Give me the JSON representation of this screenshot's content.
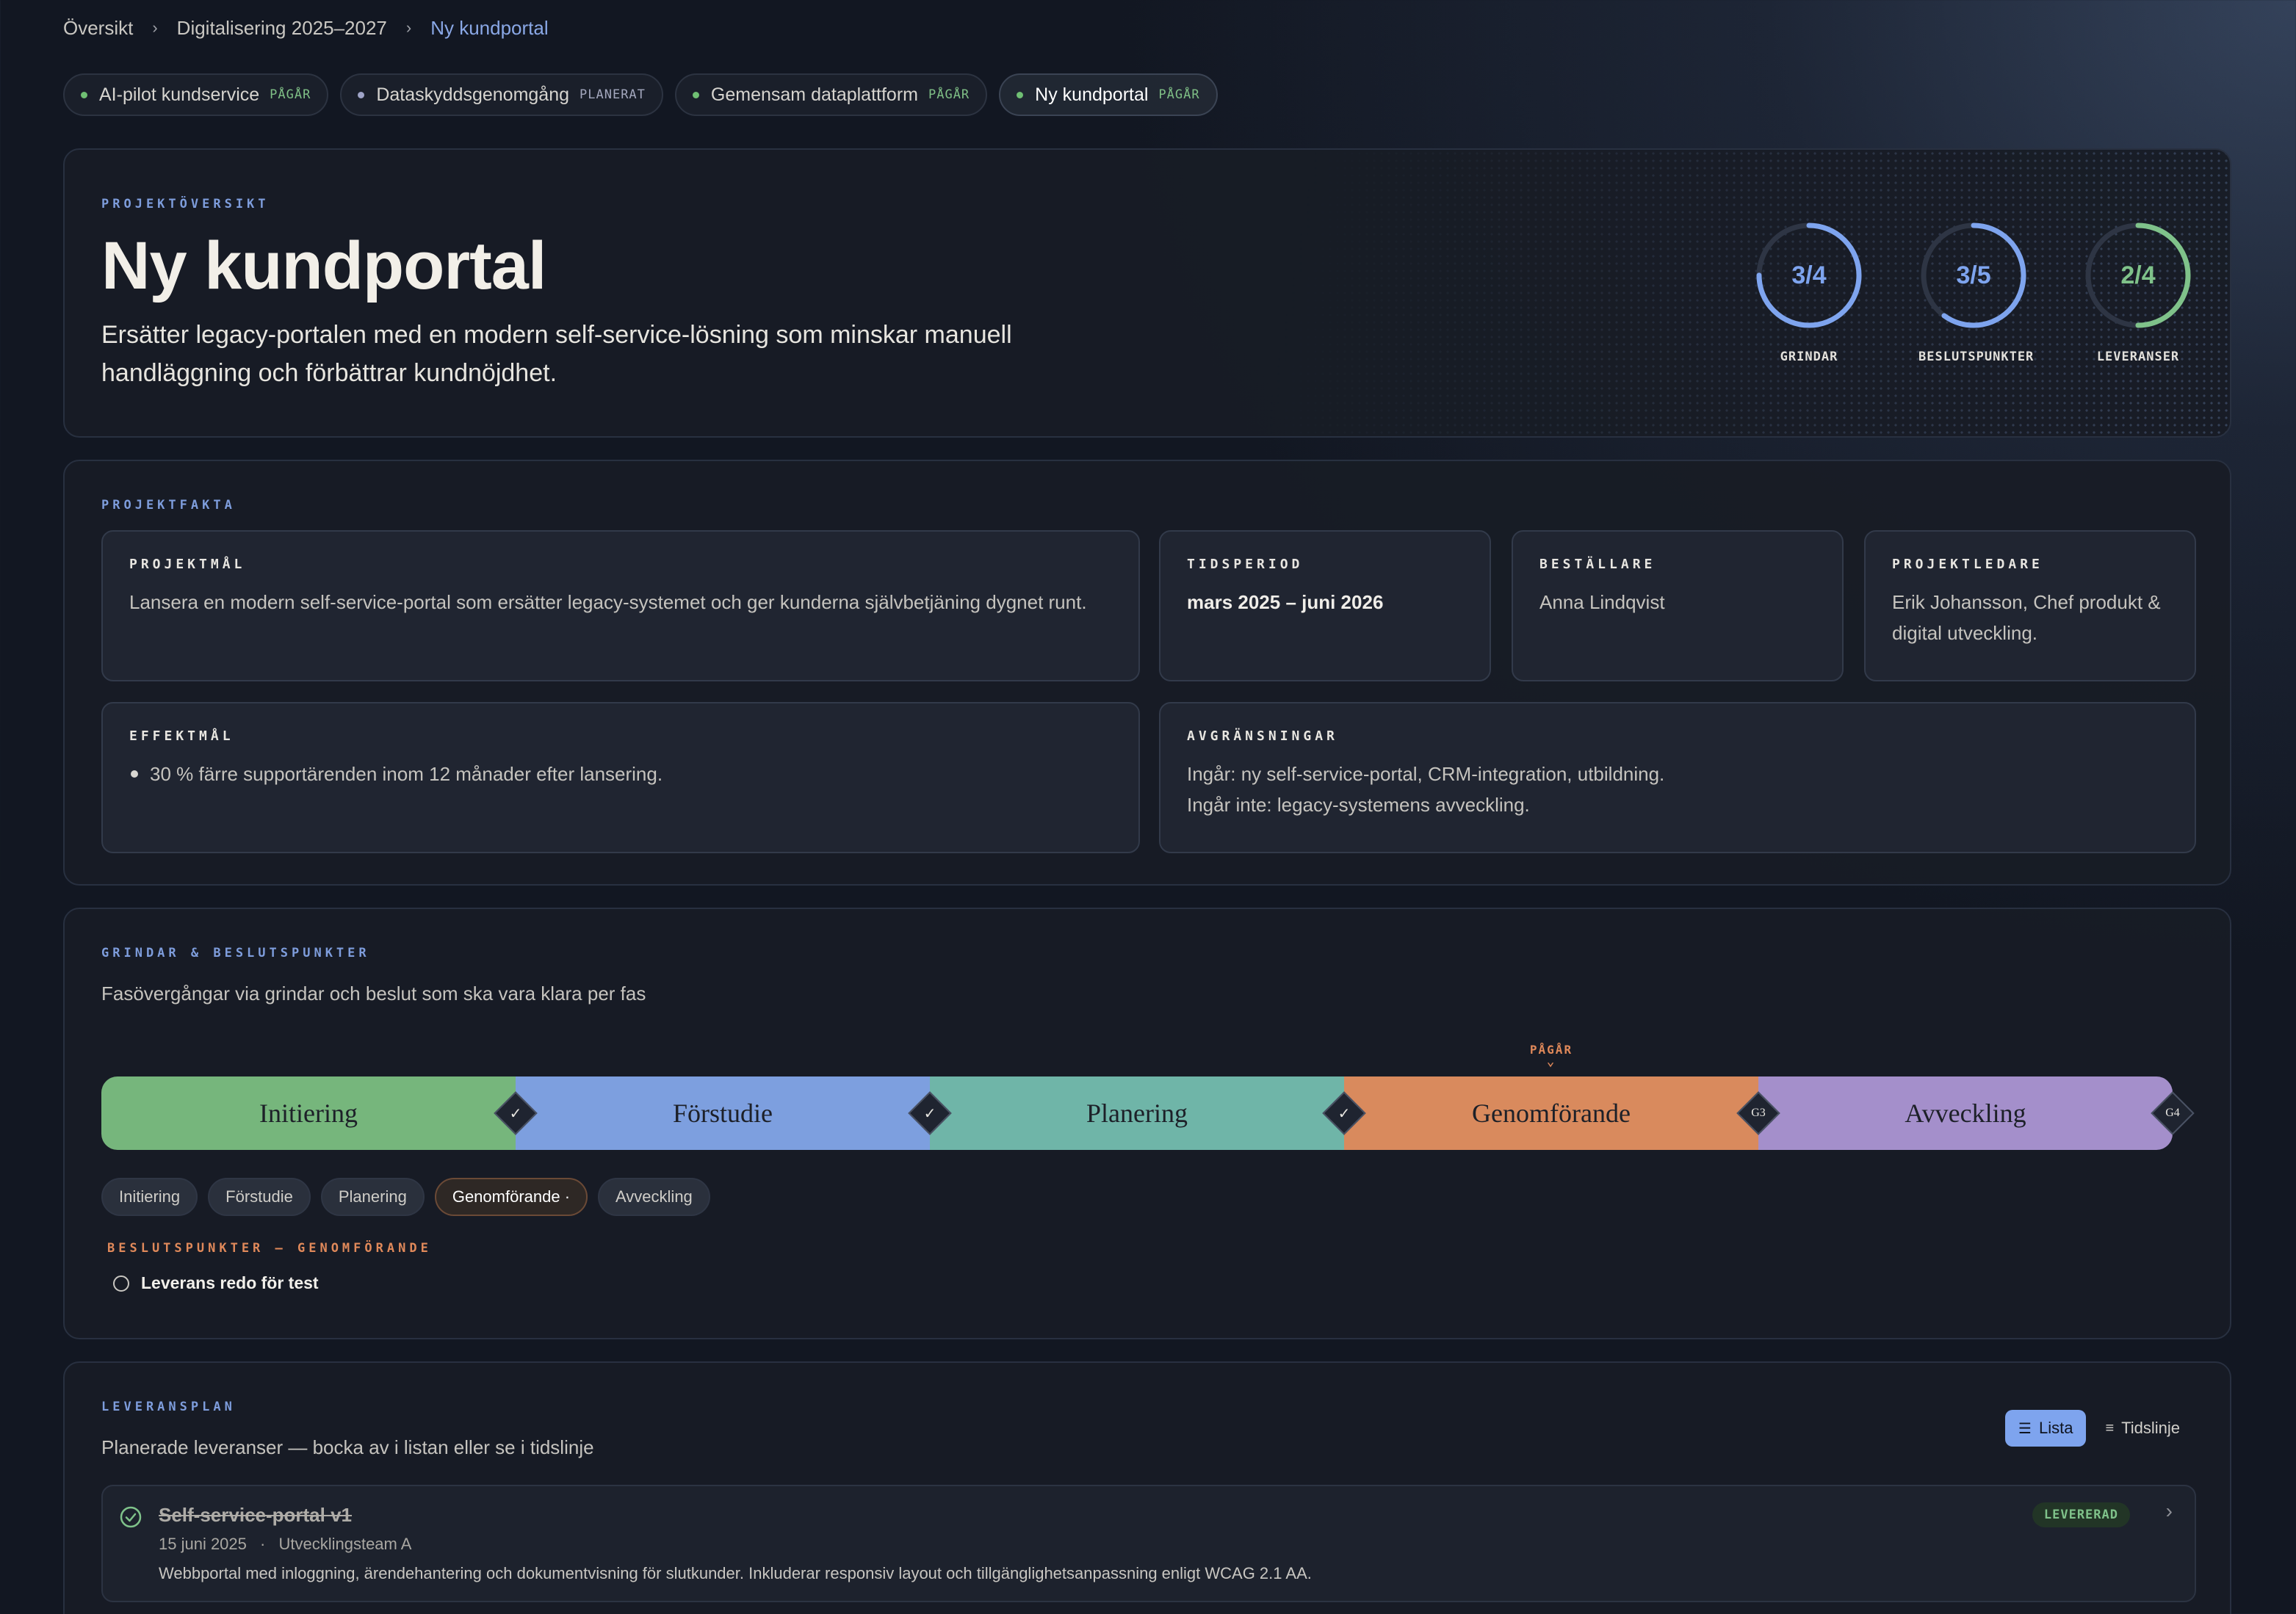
{
  "breadcrumb": [
    "Översikt",
    "Digitalisering 2025–2027",
    "Ny kundportal"
  ],
  "project_tabs": [
    {
      "name": "AI-pilot kundservice",
      "status": "PÅGÅR",
      "dot_color": "#6fbf73",
      "status_color": "#7fbf86"
    },
    {
      "name": "Dataskyddsgenomgång",
      "status": "PLANERAT",
      "dot_color": "#9fa4c8",
      "status_color": "#a3a7bd"
    },
    {
      "name": "Gemensam dataplattform",
      "status": "PÅGÅR",
      "dot_color": "#6fbf73",
      "status_color": "#7fbf86"
    },
    {
      "name": "Ny kundportal",
      "status": "PÅGÅR",
      "dot_color": "#6fbf73",
      "status_color": "#7fbf86",
      "active": true
    }
  ],
  "hero": {
    "label": "PROJEKTÖVERSIKT",
    "title": "Ny kundportal",
    "description": "Ersätter legacy-portalen med en modern self-service-lösning som minskar manuell handläggning och förbättrar kundnöjdhet.",
    "rings": [
      {
        "value": "3/4",
        "label": "GRINDAR",
        "fraction": 0.75,
        "color": "#7ea4ee"
      },
      {
        "value": "3/5",
        "label": "BESLUTSPUNKTER",
        "fraction": 0.6,
        "color": "#7ea4ee"
      },
      {
        "value": "2/4",
        "label": "LEVERANSER",
        "fraction": 0.5,
        "color": "#7fc28a"
      }
    ]
  },
  "facts": {
    "label": "PROJEKTFAKTA",
    "goal": {
      "label": "PROJEKTMÅL",
      "text": "Lansera en modern self-service-portal som ersätter legacy-systemet och ger kunderna självbetjäning dygnet runt."
    },
    "period": {
      "label": "TIDSPERIOD",
      "text": "mars 2025 – juni 2026"
    },
    "orderer": {
      "label": "BESTÄLLARE",
      "text": "Anna Lindqvist"
    },
    "lead": {
      "label": "PROJEKTLEDARE",
      "text": "Erik Johansson, Chef produkt & digital utveckling."
    },
    "effect": {
      "label": "EFFEKTMÅL",
      "items": [
        "30 % färre supportärenden inom 12 månader efter lansering."
      ]
    },
    "scope": {
      "label": "AVGRÄNSNINGAR",
      "included": "Ingår: ny self-service-portal, CRM-integration, utbildning.",
      "excluded": "Ingår inte: legacy-systemens avveckling."
    }
  },
  "gates": {
    "label": "GRINDAR & BESLUTSPUNKTER",
    "subtitle": "Fasövergångar via grindar och beslut som ska vara klara per fas",
    "current_flag": "PÅGÅR",
    "phases": [
      {
        "name": "Initiering",
        "color": "#76b67c"
      },
      {
        "name": "Förstudie",
        "color": "#7d9fdf"
      },
      {
        "name": "Planering",
        "color": "#6fb5a8"
      },
      {
        "name": "Genomförande",
        "color": "#d98a5d"
      },
      {
        "name": "Avveckling",
        "color": "#a48fcb"
      }
    ],
    "gate_markers": [
      {
        "icon": "check-icon",
        "text": "✓"
      },
      {
        "icon": "check-icon",
        "text": "✓"
      },
      {
        "icon": "check-icon",
        "text": "✓"
      },
      {
        "icon": "gate-label",
        "text": "G3"
      },
      {
        "icon": "gate-label",
        "text": "G4"
      }
    ],
    "pills": [
      "Initiering",
      "Förstudie",
      "Planering",
      "Genomförande ·",
      "Avveckling"
    ],
    "active_pill": 3,
    "decision_label": "BESLUTSPUNKTER — GENOMFÖRANDE",
    "decisions": [
      "Leverans redo för test"
    ]
  },
  "deliveries": {
    "label": "LEVERANSPLAN",
    "subtitle": "Planerade leveranser — bocka av i listan eller se i tidslinje",
    "view_list": "Lista",
    "view_timeline": "Tidslinje",
    "items": [
      {
        "title": "Self-service-portal v1",
        "date": "15 juni 2025",
        "team": "Utvecklingsteam A",
        "description": "Webbportal med inloggning, ärendehantering och dokumentvisning för slutkunder. Inkluderar responsiv layout och tillgänglighetsanpassning enligt WCAG 2.1 AA.",
        "status": "LEVERERAD"
      }
    ]
  }
}
